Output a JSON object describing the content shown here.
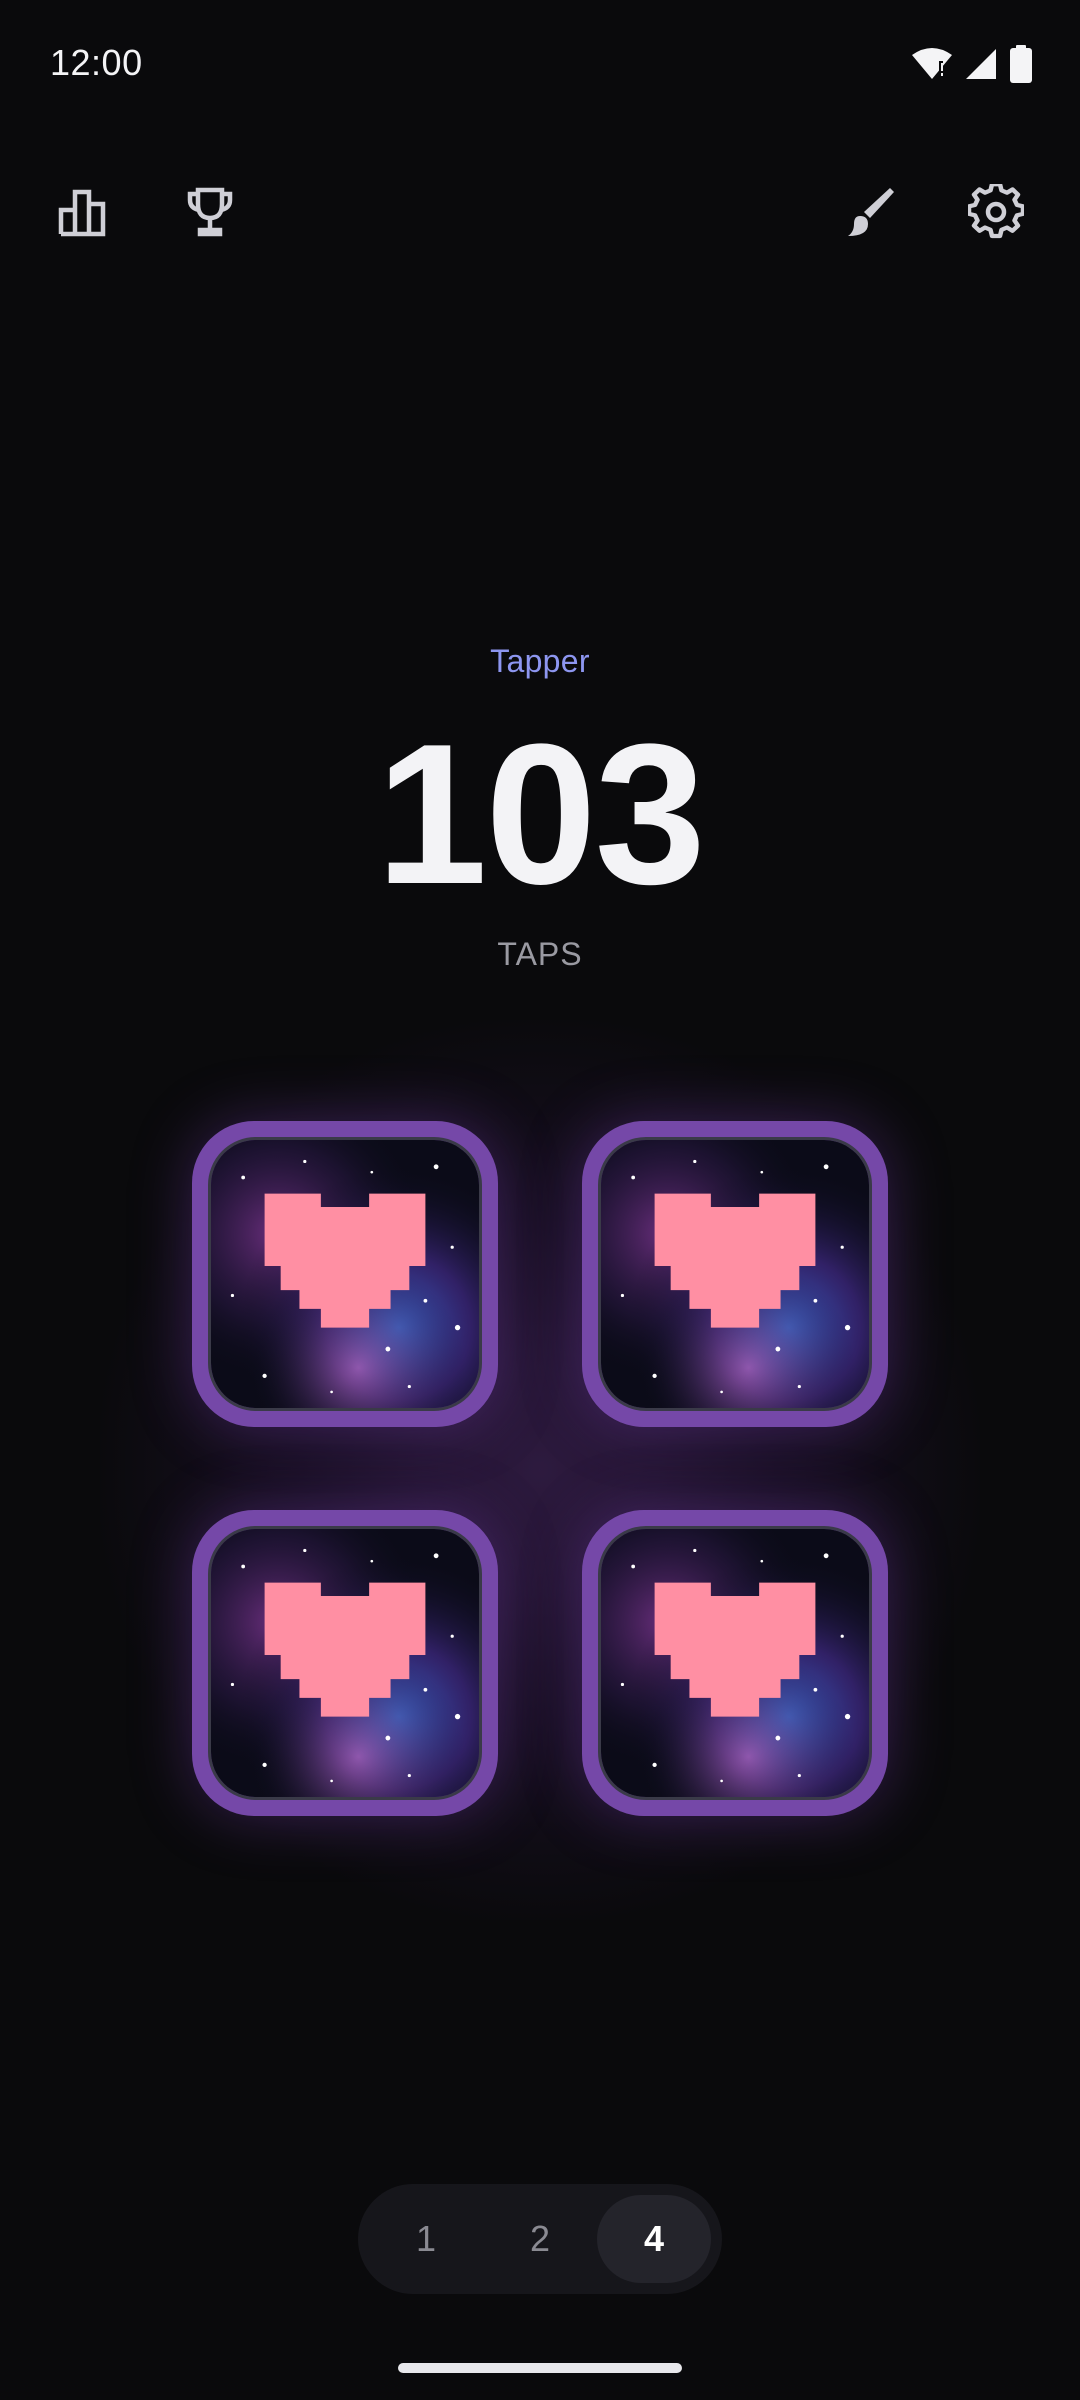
{
  "status_bar": {
    "time": "12:00"
  },
  "toolbar": {
    "left": [
      {
        "icon": "bar-chart-icon",
        "action": "stats"
      },
      {
        "icon": "trophy-icon",
        "action": "achievements"
      }
    ],
    "right": [
      {
        "icon": "brush-icon",
        "action": "theme"
      },
      {
        "icon": "gear-icon",
        "action": "settings"
      }
    ]
  },
  "counter": {
    "app_name": "Tapper",
    "count": "103",
    "unit": "TAPS"
  },
  "tiles": [
    {
      "icon": "pixel-heart-icon",
      "background": "galaxy"
    },
    {
      "icon": "pixel-heart-icon",
      "background": "galaxy"
    },
    {
      "icon": "pixel-heart-icon",
      "background": "galaxy"
    },
    {
      "icon": "pixel-heart-icon",
      "background": "galaxy"
    }
  ],
  "mode_selector": {
    "options": [
      {
        "label": "1"
      },
      {
        "label": "2"
      },
      {
        "label": "4"
      }
    ],
    "selected": "4"
  },
  "colors": {
    "background": "#0a0a0c",
    "accent_text": "#8d96f0",
    "tile_frame": "#7548a8",
    "heart": "#ff8fa3"
  }
}
